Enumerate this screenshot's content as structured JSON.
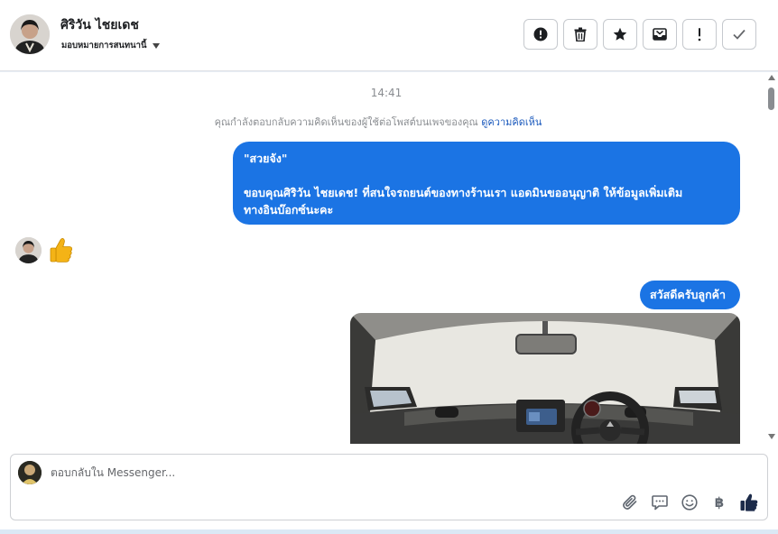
{
  "header": {
    "name": "ศิริวัน ไชยเดช",
    "assign_label": "มอบหมายการสนทนานี้",
    "actions": [
      {
        "icon": "alert-circle-icon",
        "name": "mark-important-button"
      },
      {
        "icon": "trash-icon",
        "name": "delete-button"
      },
      {
        "icon": "star-icon",
        "name": "star-button"
      },
      {
        "icon": "archive-icon",
        "name": "archive-button"
      },
      {
        "icon": "exclamation-icon",
        "name": "mark-spam-button"
      },
      {
        "icon": "check-icon",
        "name": "mark-done-button"
      }
    ]
  },
  "chat": {
    "timestamp": "14:41",
    "notice_text": "คุณกำลังตอบกลับความคิดเห็นของผู้ใช้ต่อโพสต์บนเพจของคุณ ",
    "notice_link": "ดูความคิดเห็น",
    "message1": {
      "quote": "\"สวยจัง\"",
      "line1": "ขอบคุณศิริวัน ไชยเดช! ที่สนใจรถยนต์ของทางร้านเรา แอดมินขออนุญาติ ให้ข้อมูลเพิ่มเติม",
      "line2": "ทางอินบ๊อกซ์นะคะ"
    },
    "incoming_emoji": "👍",
    "message2": "สวัสดีครับลูกค้า"
  },
  "composer": {
    "placeholder": "ตอบกลับใน Messenger...",
    "tools": [
      "paperclip-icon",
      "chat-bubble-icon",
      "emoji-icon",
      "baht-icon",
      "thumbs-up-icon"
    ],
    "baht_symbol": "฿"
  },
  "colors": {
    "bubble": "#1b74e4",
    "accent": "#1d5bbd",
    "like": "#1c2b4a"
  }
}
